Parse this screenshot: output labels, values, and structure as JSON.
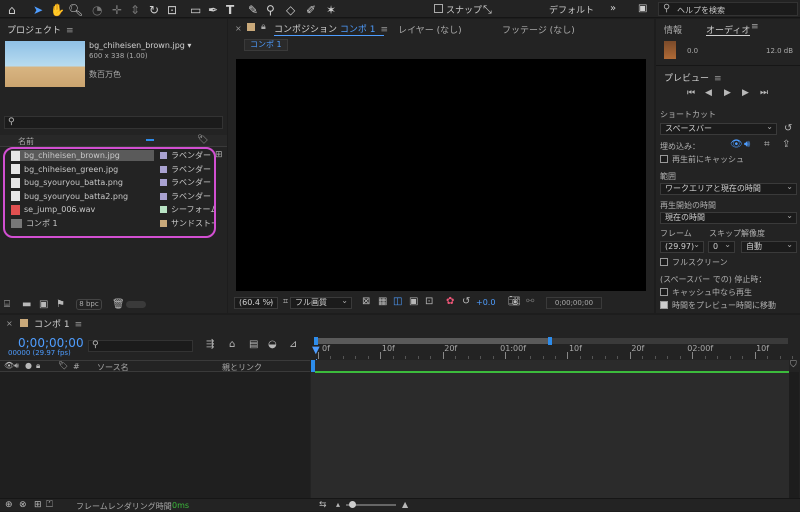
{
  "toolbar": {
    "snap_label": "スナップ",
    "workspace": "デフォルト",
    "help_placeholder": "ヘルプを検索"
  },
  "project": {
    "tab": "プロジェクト",
    "preview_file": "bg_chiheisen_brown.jpg ▾",
    "preview_info": "600 x 338 (1.00)",
    "preview_colors": "数百万色",
    "col_name": "名前",
    "items": [
      {
        "name": "bg_chiheisen_brown.jpg",
        "label": "ラベンダー",
        "color": "#a9a2d1",
        "icon": "image-file-icon",
        "selected": true
      },
      {
        "name": "bg_chiheisen_green.jpg",
        "label": "ラベンダー",
        "color": "#a9a2d1",
        "icon": "image-file-icon",
        "selected": false
      },
      {
        "name": "bug_syouryou_batta.png",
        "label": "ラベンダー",
        "color": "#a9a2d1",
        "icon": "image-file-icon",
        "selected": false
      },
      {
        "name": "bug_syouryou_batta2.png",
        "label": "ラベンダー",
        "color": "#a9a2d1",
        "icon": "image-file-icon",
        "selected": false
      },
      {
        "name": "se_jump_006.wav",
        "label": "シーフォーム",
        "color": "#b8e3c4",
        "icon": "audio-file-icon",
        "selected": false
      },
      {
        "name": "コンポ 1",
        "label": "サンドストーン",
        "color": "#c9a97a",
        "icon": "composition-icon",
        "selected": false
      }
    ],
    "bpc": "8 bpc"
  },
  "composition": {
    "tab_prefix": "コンポジション",
    "tab_name": "コンポ 1",
    "layer_tab": "レイヤー (なし)",
    "footage_tab": "フッテージ (なし)",
    "sub_tab": "コンポ 1",
    "zoom": "(60.4 %)",
    "quality": "フル画質",
    "exposure": "+0.0",
    "timecode": "0;00;00;00"
  },
  "info": {
    "tab_info": "情報",
    "tab_audio": "オーディオ",
    "meter_left": "0.0",
    "meter_right": "12.0 dB"
  },
  "preview": {
    "tab": "プレビュー",
    "shortcut_label": "ショートカット",
    "shortcut_value": "スペースバー",
    "embed_label": "埋め込み：",
    "cache_before": "再生前にキャッシュ",
    "range_label": "範囲",
    "range_value": "ワークエリアと現在の時間",
    "start_label": "再生開始の時間",
    "start_value": "現在の時間",
    "frame_label": "フレーム",
    "skip_label": "スキップ",
    "res_label": "解像度",
    "frame_value": "(29.97)",
    "skip_value": "0",
    "res_value": "自動",
    "fullscreen": "フルスクリーン",
    "stop_label": "(スペースバー での) 停止時：",
    "if_caching": "キャッシュ中なら再生",
    "move_time": "時間をプレビュー時間に移動"
  },
  "timeline": {
    "tab": "コンポ 1",
    "timecode": "0;00;00;00",
    "fps": "00000 (29.97 fps)",
    "col_hash": "#",
    "col_source": "ソース名",
    "col_parent": "親とリンク",
    "ruler": [
      "0f",
      "10f",
      "20f",
      "01:00f",
      "10f",
      "20f",
      "02:00f",
      "10f"
    ],
    "render_label": "フレームレンダリング時間",
    "render_value": "0ms"
  },
  "colors": {
    "accent_blue": "#2d8ceb",
    "highlight_magenta": "#d24fd2",
    "green_bar": "#3cbb3c",
    "timecode_blue": "#4e9dff"
  }
}
